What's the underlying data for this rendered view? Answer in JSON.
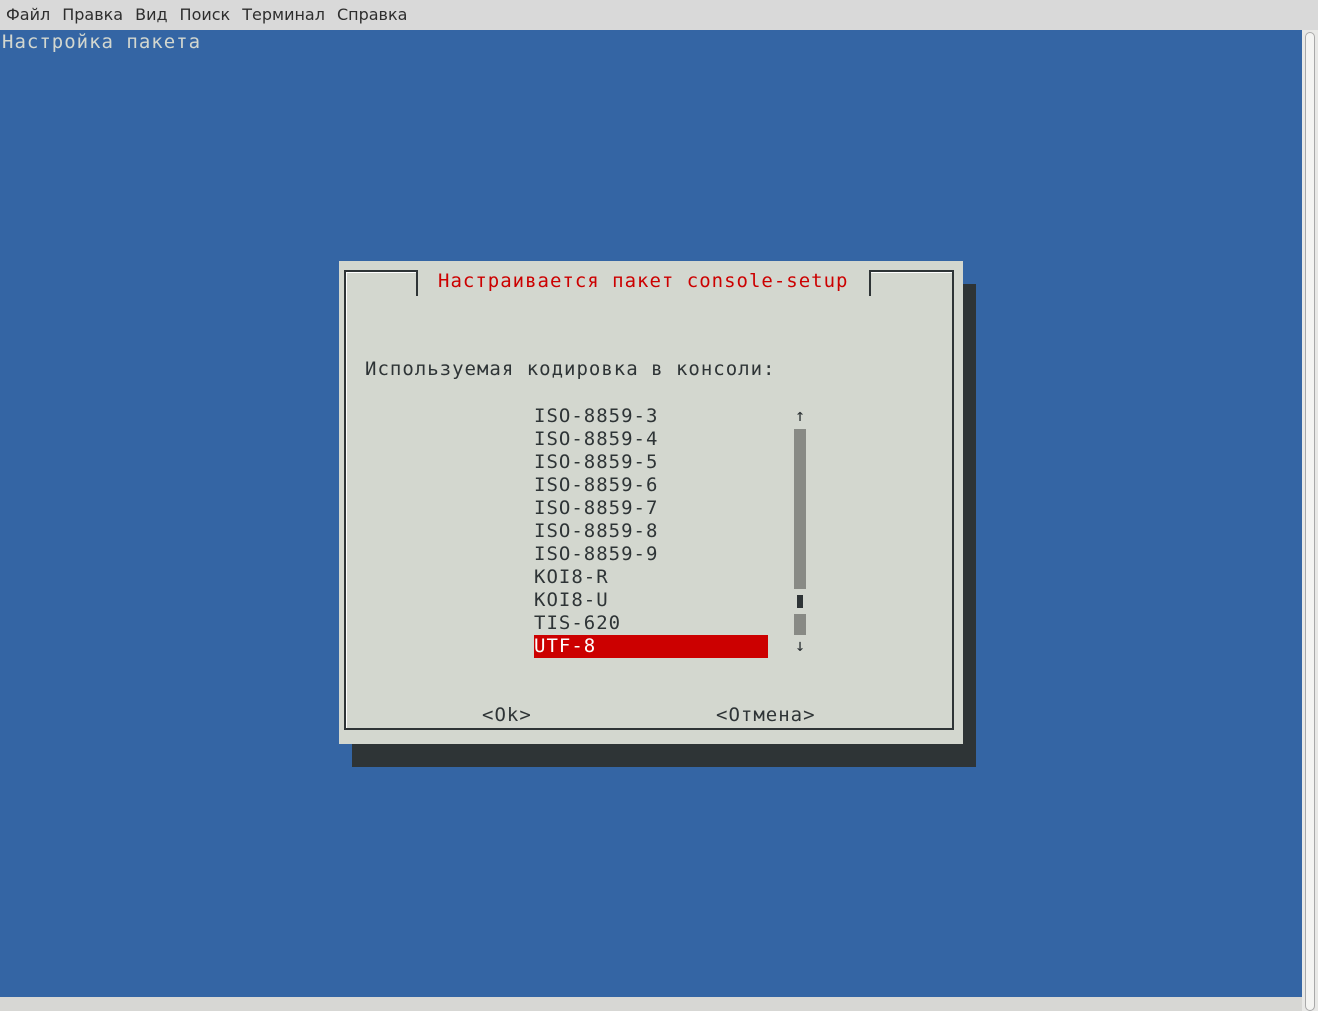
{
  "menubar": {
    "items": [
      "Файл",
      "Правка",
      "Вид",
      "Поиск",
      "Терминал",
      "Справка"
    ]
  },
  "terminal": {
    "header_text": "Настройка пакета"
  },
  "dialog": {
    "title": "Настраивается пакет console-setup",
    "prompt": "Используемая кодировка в консоли:",
    "options": [
      "ISO-8859-3",
      "ISO-8859-4",
      "ISO-8859-5",
      "ISO-8859-6",
      "ISO-8859-7",
      "ISO-8859-8",
      "ISO-8859-9",
      "KOI8-R",
      "KOI8-U",
      "TIS-620",
      "UTF-8"
    ],
    "selected": "UTF-8",
    "scroll_up": "↑",
    "scroll_down": "↓",
    "ok_label": "<Ok>",
    "cancel_label": "<Отмена>"
  },
  "colors": {
    "terminal_bg": "#3465a4",
    "dialog_bg": "#d3d7cf",
    "accent": "#cc0000",
    "shadow": "#2e3436"
  }
}
